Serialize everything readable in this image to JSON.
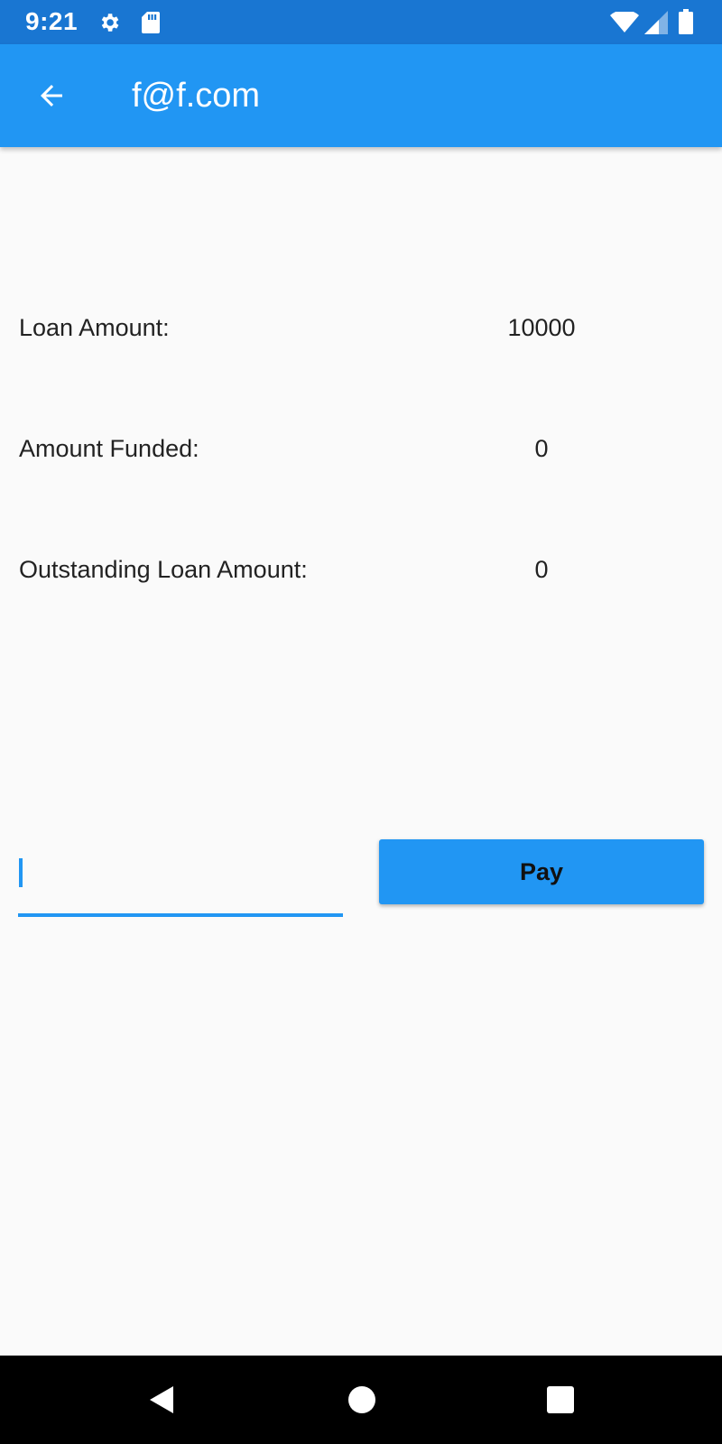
{
  "status_bar": {
    "time": "9:21",
    "icons": [
      "gear-icon",
      "sd-card-icon",
      "wifi-icon",
      "signal-icon",
      "battery-icon"
    ]
  },
  "app_bar": {
    "title": "f@f.com",
    "back_icon": "arrow-back-icon"
  },
  "loan_info": {
    "loan_amount": {
      "label": "Loan Amount:",
      "value": "10000"
    },
    "amount_funded": {
      "label": "Amount Funded:",
      "value": "0"
    },
    "outstanding": {
      "label": "Outstanding Loan Amount:",
      "value": "0"
    }
  },
  "payment": {
    "input_value": "",
    "pay_label": "Pay"
  },
  "nav_bar": {
    "icons": [
      "back-triangle-icon",
      "home-circle-icon",
      "recents-square-icon"
    ]
  },
  "colors": {
    "status_bar": "#1976d2",
    "primary": "#2196f3",
    "background": "#fafafa"
  }
}
